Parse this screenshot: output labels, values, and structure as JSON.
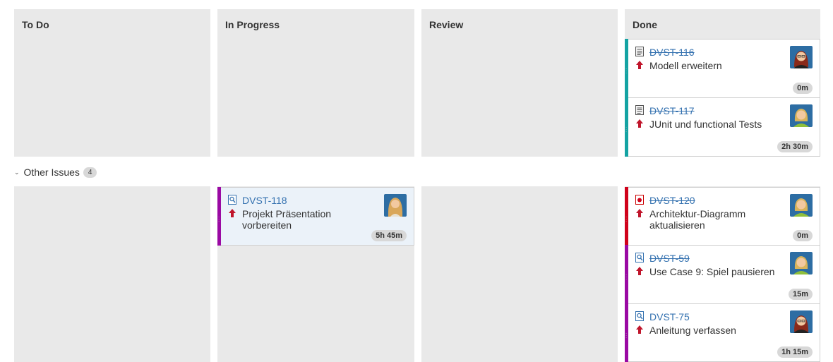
{
  "columns": [
    {
      "name": "To Do"
    },
    {
      "name": "In Progress"
    },
    {
      "name": "Review"
    },
    {
      "name": "Done"
    }
  ],
  "swimlane": {
    "label": "Other Issues",
    "count": "4"
  },
  "colors": {
    "column_bg": "#e9e9e9",
    "link": "#3572b0",
    "epic_teal": "#14a3a3",
    "epic_red": "#d0021b",
    "epic_purple": "#9a0aa3",
    "priority_red": "#d04437",
    "inprogress_card_bg": "#ebf2f9"
  },
  "cards": [
    {
      "key": "DVST-116",
      "summary": "Modell erweitern",
      "estimate": "0m",
      "done": true,
      "type_icon": "document-icon",
      "priority": "major-arrow-up",
      "avatar": "female-red-hair"
    },
    {
      "key": "DVST-117",
      "summary": "JUnit und functional Tests",
      "estimate": "2h 30m",
      "done": true,
      "type_icon": "document-icon",
      "priority": "major-arrow-up",
      "avatar": "female-blonde"
    },
    {
      "key": "DVST-118",
      "summary": "Projekt Präsentation vorbereiten",
      "estimate": "5h 45m",
      "done": false,
      "type_icon": "magnifier-icon",
      "priority": "major-arrow-up",
      "avatar": "female-long-hair"
    },
    {
      "key": "DVST-120",
      "summary": "Architektur-Diagramm aktualisieren",
      "estimate": "0m",
      "done": true,
      "type_icon": "bug-icon",
      "priority": "major-arrow-up",
      "avatar": "female-blonde"
    },
    {
      "key": "DVST-59",
      "summary": "Use Case 9: Spiel pausieren",
      "estimate": "15m",
      "done": true,
      "type_icon": "magnifier-icon",
      "priority": "major-arrow-up",
      "avatar": "female-blonde"
    },
    {
      "key": "DVST-75",
      "summary": "Anleitung verfassen",
      "estimate": "1h 15m",
      "done": false,
      "type_icon": "magnifier-icon",
      "priority": "major-arrow-up",
      "avatar": "female-red-hair"
    }
  ]
}
